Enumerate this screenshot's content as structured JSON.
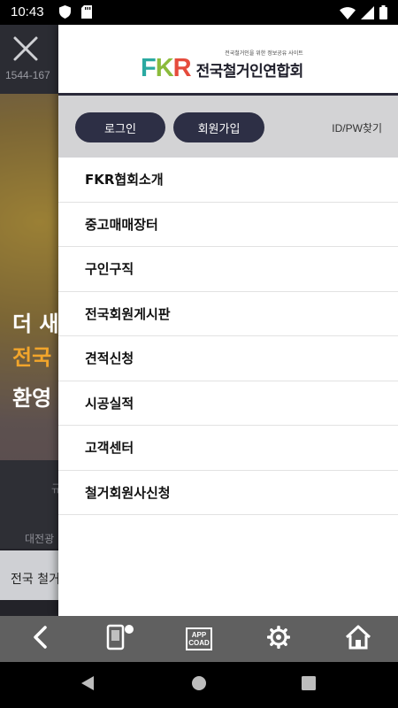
{
  "status_bar": {
    "time": "10:43"
  },
  "background_app": {
    "phone": "1544-167",
    "hero_line1": "더 새",
    "hero_line2": "전국",
    "hero_line3": "환영",
    "lower_text1": "대전광",
    "lower_text2": "규",
    "strip_text": "전국 철거"
  },
  "drawer": {
    "logo": {
      "letters": [
        "F",
        "K",
        "R"
      ],
      "tagline": "전국철거인을 위한 정보공유 사이트",
      "name": "전국철거인연합회"
    },
    "auth": {
      "login_label": "로그인",
      "signup_label": "회원가입",
      "find_label": "ID/PW찾기"
    },
    "menu": [
      {
        "label": "FKR협회소개"
      },
      {
        "label": "중고매매장터"
      },
      {
        "label": "구인구직"
      },
      {
        "label": "전국회원게시판"
      },
      {
        "label": "견적신청"
      },
      {
        "label": "시공실적"
      },
      {
        "label": "고객센터"
      },
      {
        "label": "철거회원사신청"
      }
    ]
  },
  "toolbar": {
    "app_coad_line1": "APP",
    "app_coad_line2": "COAD",
    "items": [
      "back-icon",
      "mobile-card-icon",
      "app-coad-icon",
      "gear-icon",
      "home-icon"
    ]
  },
  "colors": {
    "drawer_button": "#2d2f45",
    "hero_accent": "#f2a52b",
    "toolbar_bg": "#606060",
    "auth_bar_bg": "#d3d3d5"
  }
}
